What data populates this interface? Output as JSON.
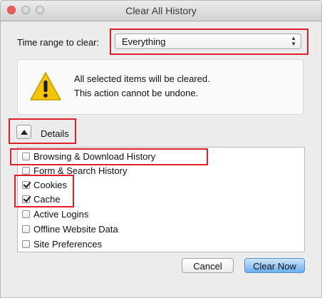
{
  "window": {
    "title": "Clear All History"
  },
  "time_range": {
    "label": "Time range to clear:",
    "selected": "Everything"
  },
  "warning": {
    "line1": "All selected items will be cleared.",
    "line2": "This action cannot be undone."
  },
  "details": {
    "label": "Details",
    "expanded": true
  },
  "items": [
    {
      "label": "Browsing & Download History",
      "checked": false
    },
    {
      "label": "Form & Search History",
      "checked": false
    },
    {
      "label": "Cookies",
      "checked": true
    },
    {
      "label": "Cache",
      "checked": true
    },
    {
      "label": "Active Logins",
      "checked": false
    },
    {
      "label": "Offline Website Data",
      "checked": false
    },
    {
      "label": "Site Preferences",
      "checked": false
    }
  ],
  "buttons": {
    "cancel": "Cancel",
    "clear_now": "Clear Now"
  },
  "colors": {
    "highlight": "#e01f2a",
    "default_button": "#6aaef0",
    "warning_yellow": "#f5c400"
  }
}
